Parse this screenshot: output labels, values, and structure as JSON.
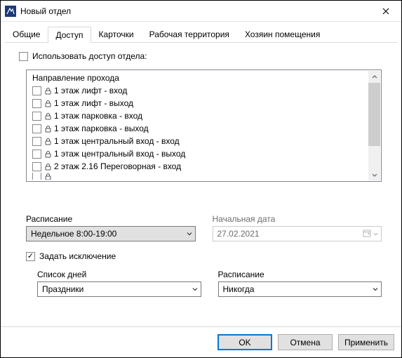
{
  "window": {
    "title": "Новый отдел"
  },
  "tabs": {
    "items": [
      {
        "label": "Общие"
      },
      {
        "label": "Доступ"
      },
      {
        "label": "Карточки"
      },
      {
        "label": "Рабочая территория"
      },
      {
        "label": "Хозяин помещения"
      }
    ],
    "active_index": 1
  },
  "use_dept_access": {
    "label": "Использовать доступ отдела:",
    "checked": false
  },
  "passage": {
    "header": "Направление прохода",
    "items": [
      {
        "label": "1 этаж лифт - вход",
        "checked": false
      },
      {
        "label": "1 этаж лифт - выход",
        "checked": false
      },
      {
        "label": "1 этаж парковка - вход",
        "checked": false
      },
      {
        "label": "1 этаж парковка - выход",
        "checked": false
      },
      {
        "label": "1 этаж центральный вход - вход",
        "checked": false
      },
      {
        "label": "1 этаж центральный вход - выход",
        "checked": false
      },
      {
        "label": "2 этаж 2.16 Переговорная - вход",
        "checked": false
      }
    ]
  },
  "schedule": {
    "label": "Расписание",
    "value": "Недельное 8:00-19:00"
  },
  "start_date": {
    "label": "Начальная дата",
    "value": "27.02.2021"
  },
  "exception": {
    "label": "Задать исключение",
    "checked": true
  },
  "days_list": {
    "label": "Список дней",
    "value": "Праздники"
  },
  "exc_schedule": {
    "label": "Расписание",
    "value": "Никогда"
  },
  "buttons": {
    "ok": "OK",
    "cancel": "Отмена",
    "apply": "Применить"
  }
}
